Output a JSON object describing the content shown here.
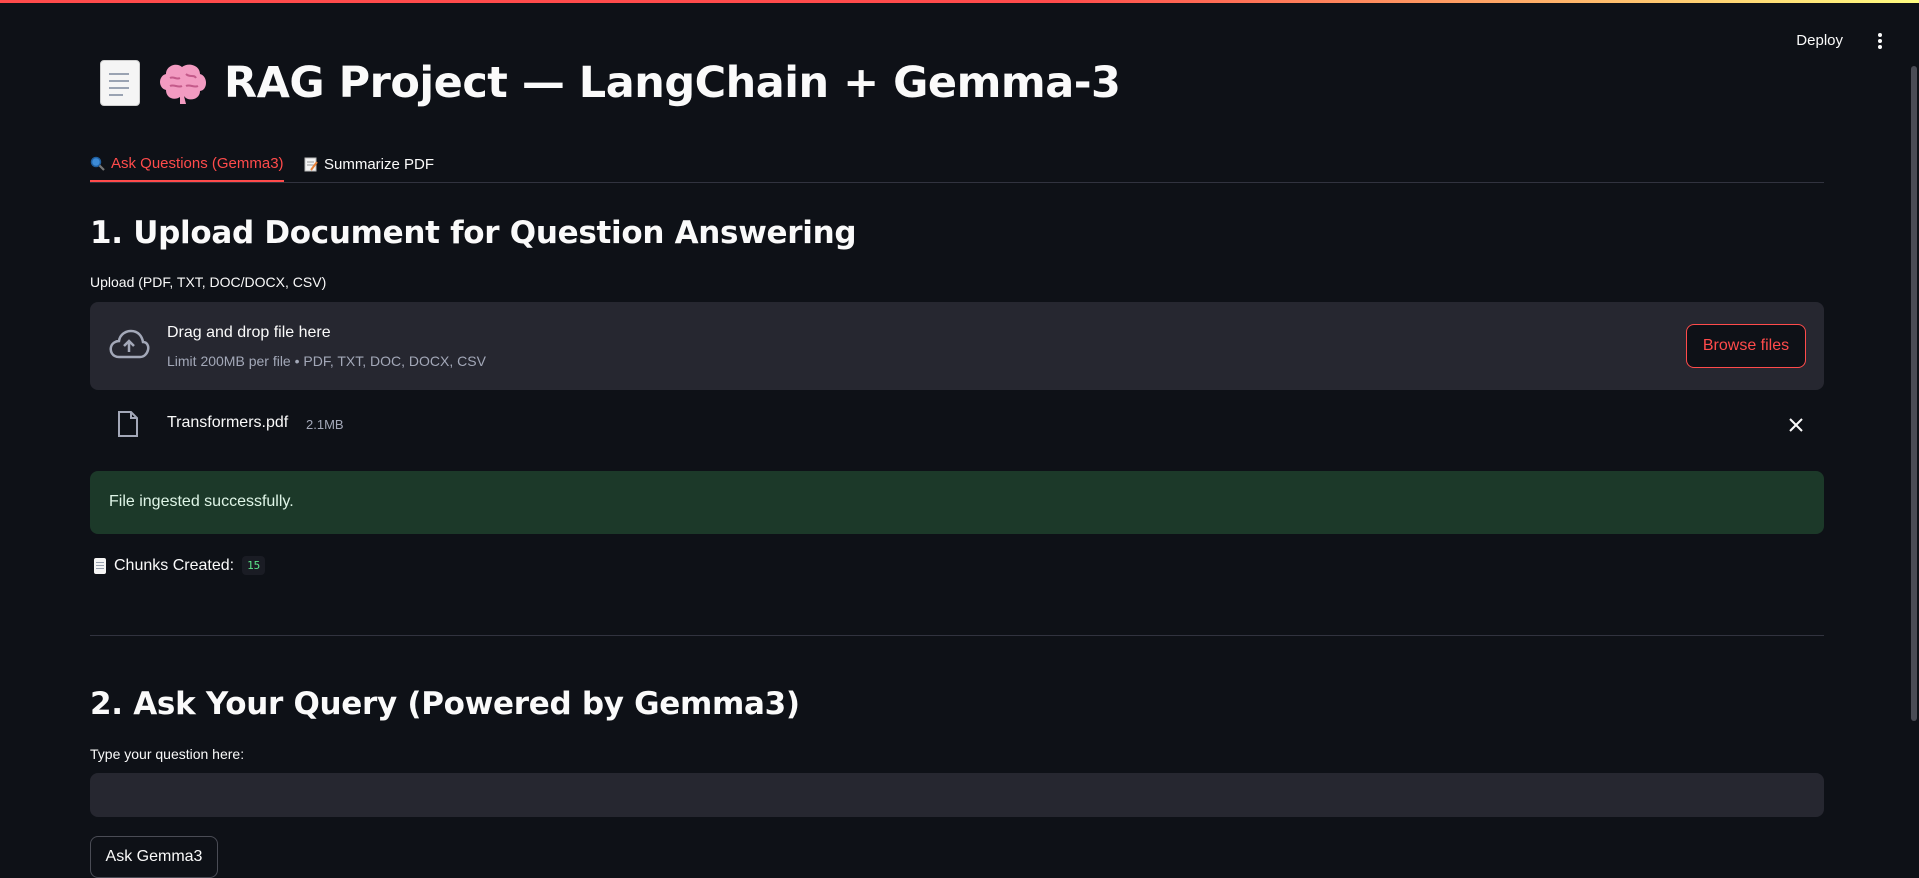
{
  "header": {
    "deploy_label": "Deploy",
    "menu_icon": "kebab-menu-icon"
  },
  "page": {
    "title": "RAG Project — LangChain + Gemma-3",
    "title_icons": [
      "page-facing-up-icon",
      "brain-icon"
    ]
  },
  "tabs": [
    {
      "label": "Ask Questions (Gemma3)",
      "icon": "magnifying-glass-icon",
      "active": true
    },
    {
      "label": "Summarize PDF",
      "icon": "memo-icon",
      "active": false
    }
  ],
  "section1": {
    "heading": "1. Upload Document for Question Answering",
    "upload_label": "Upload (PDF, TXT, DOC/DOCX, CSV)",
    "dropzone": {
      "main_text": "Drag and drop file here",
      "sub_text": "Limit 200MB per file • PDF, TXT, DOC, DOCX, CSV",
      "browse_label": "Browse files"
    },
    "file": {
      "name": "Transformers.pdf",
      "size": "2.1MB"
    },
    "success_message": "File ingested successfully.",
    "chunks_label": "Chunks Created:",
    "chunks_value": "15"
  },
  "section2": {
    "heading": "2. Ask Your Query (Powered by Gemma3)",
    "question_label": "Type your question here:",
    "question_value": "",
    "ask_button": "Ask Gemma3"
  },
  "colors": {
    "background": "#0e1117",
    "accent": "#ff4b4b",
    "success_bg": "#1c3929",
    "panel": "#262730"
  }
}
